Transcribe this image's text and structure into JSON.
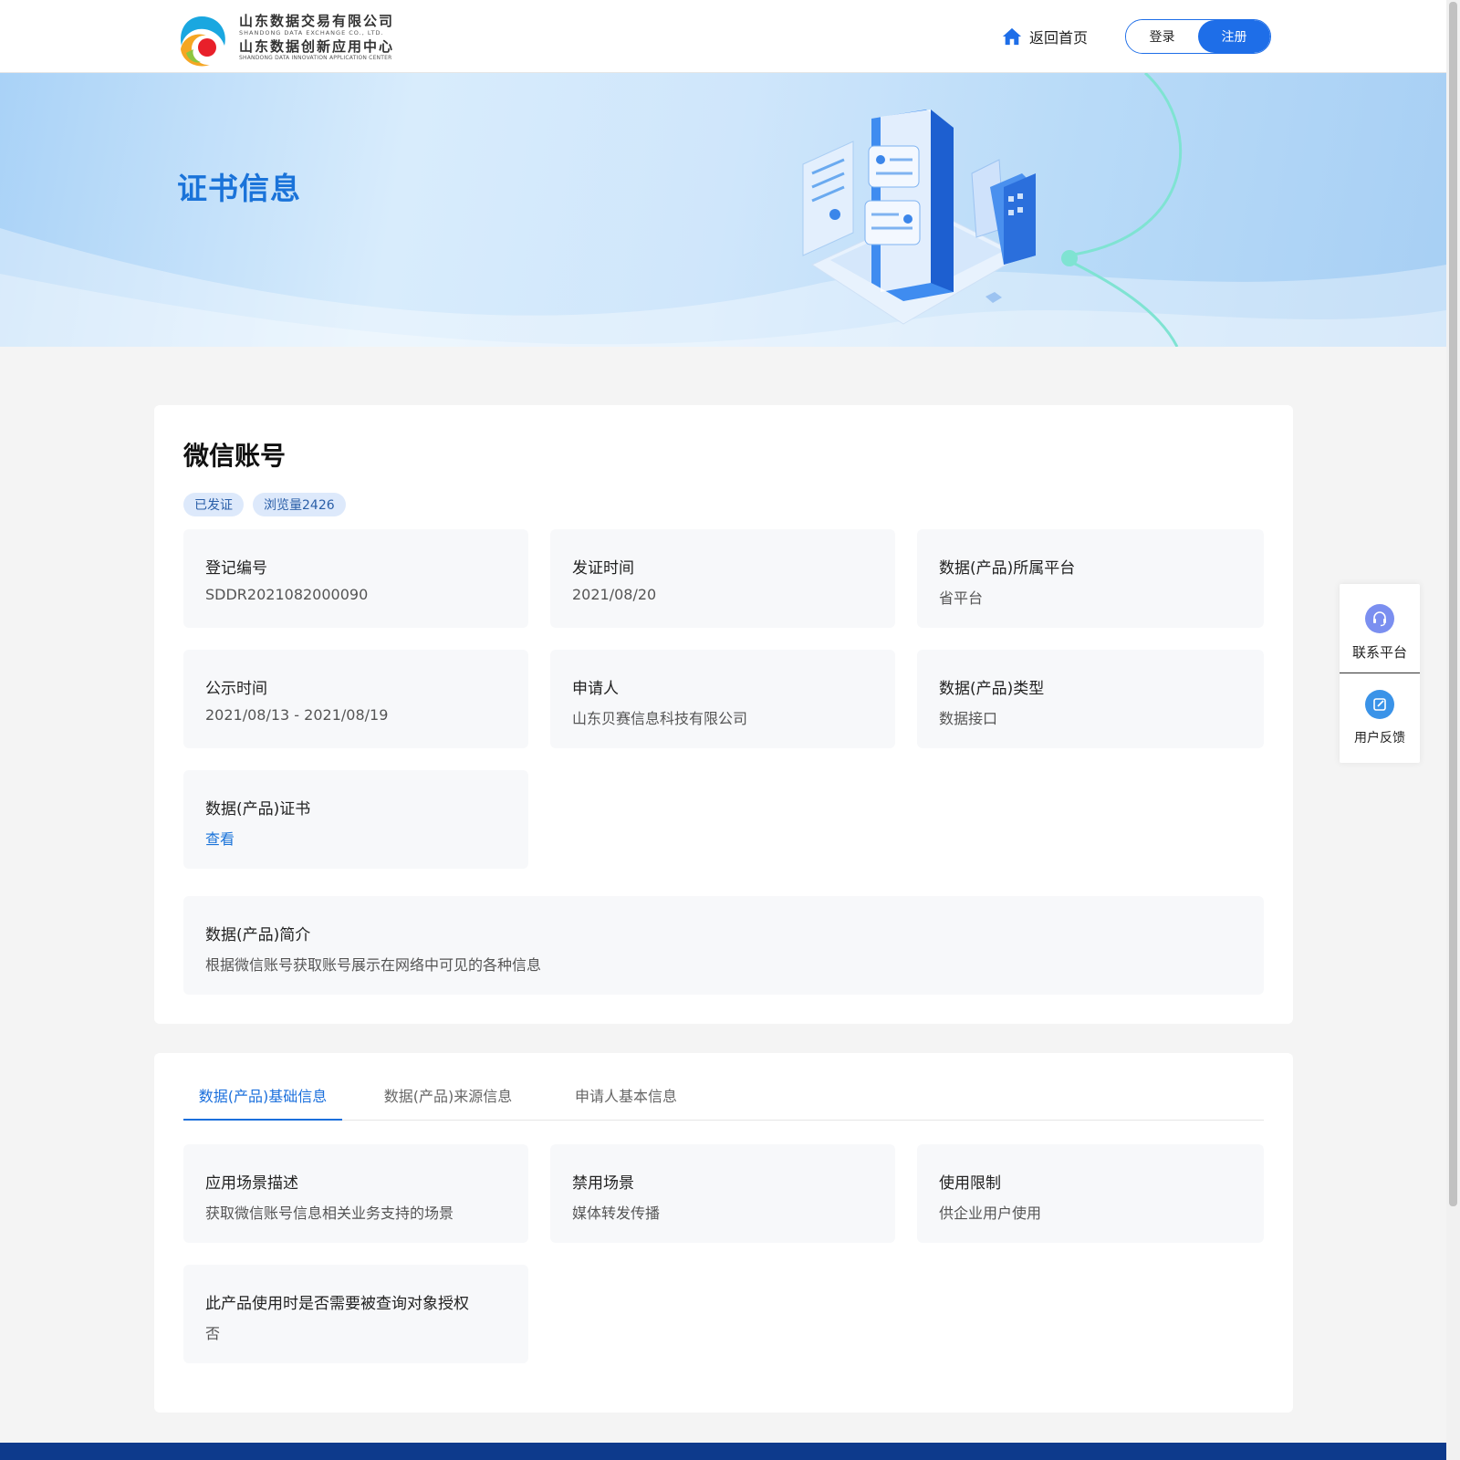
{
  "header": {
    "logo": {
      "cn_line1": "山东数据交易有限公司",
      "en_line1": "SHANDONG DATA EXCHANGE CO., LTD.",
      "cn_line2": "山东数据创新应用中心",
      "en_line2": "SHANDONG DATA INNOVATION APPLICATION CENTER"
    },
    "home_label": "返回首页",
    "login_label": "登录",
    "register_label": "注册"
  },
  "banner": {
    "title": "证书信息"
  },
  "product": {
    "name": "微信账号",
    "tags": [
      "已发证",
      "浏览量2426"
    ],
    "fields": [
      {
        "label": "登记编号",
        "value": "SDDR2021082000090"
      },
      {
        "label": "发证时间",
        "value": "2021/08/20"
      },
      {
        "label": "数据(产品)所属平台",
        "value": "省平台"
      },
      {
        "label": "公示时间",
        "value": "2021/08/13 - 2021/08/19"
      },
      {
        "label": "申请人",
        "value": "山东贝赛信息科技有限公司"
      },
      {
        "label": "数据(产品)类型",
        "value": "数据接口"
      },
      {
        "label": "数据(产品)证书",
        "value": "查看"
      }
    ],
    "intro": {
      "label": "数据(产品)简介",
      "value": "根据微信账号获取账号展示在网络中可见的各种信息"
    }
  },
  "tabs": {
    "items": [
      "数据(产品)基础信息",
      "数据(产品)来源信息",
      "申请人基本信息"
    ],
    "active_index": 0,
    "fields": [
      {
        "label": "应用场景描述",
        "value": "获取微信账号信息相关业务支持的场景"
      },
      {
        "label": "禁用场景",
        "value": "媒体转发传播"
      },
      {
        "label": "使用限制",
        "value": "供企业用户使用"
      },
      {
        "label": "此产品使用时是否需要被查询对象授权",
        "value": "否"
      }
    ]
  },
  "side_panel": {
    "contact_label": "联系平台",
    "feedback_label": "用户反馈"
  },
  "colors": {
    "accent": "#1e6ee8",
    "link": "#1a73d9",
    "footer": "#0d3a8c",
    "tag_bg": "#dde9fb"
  }
}
